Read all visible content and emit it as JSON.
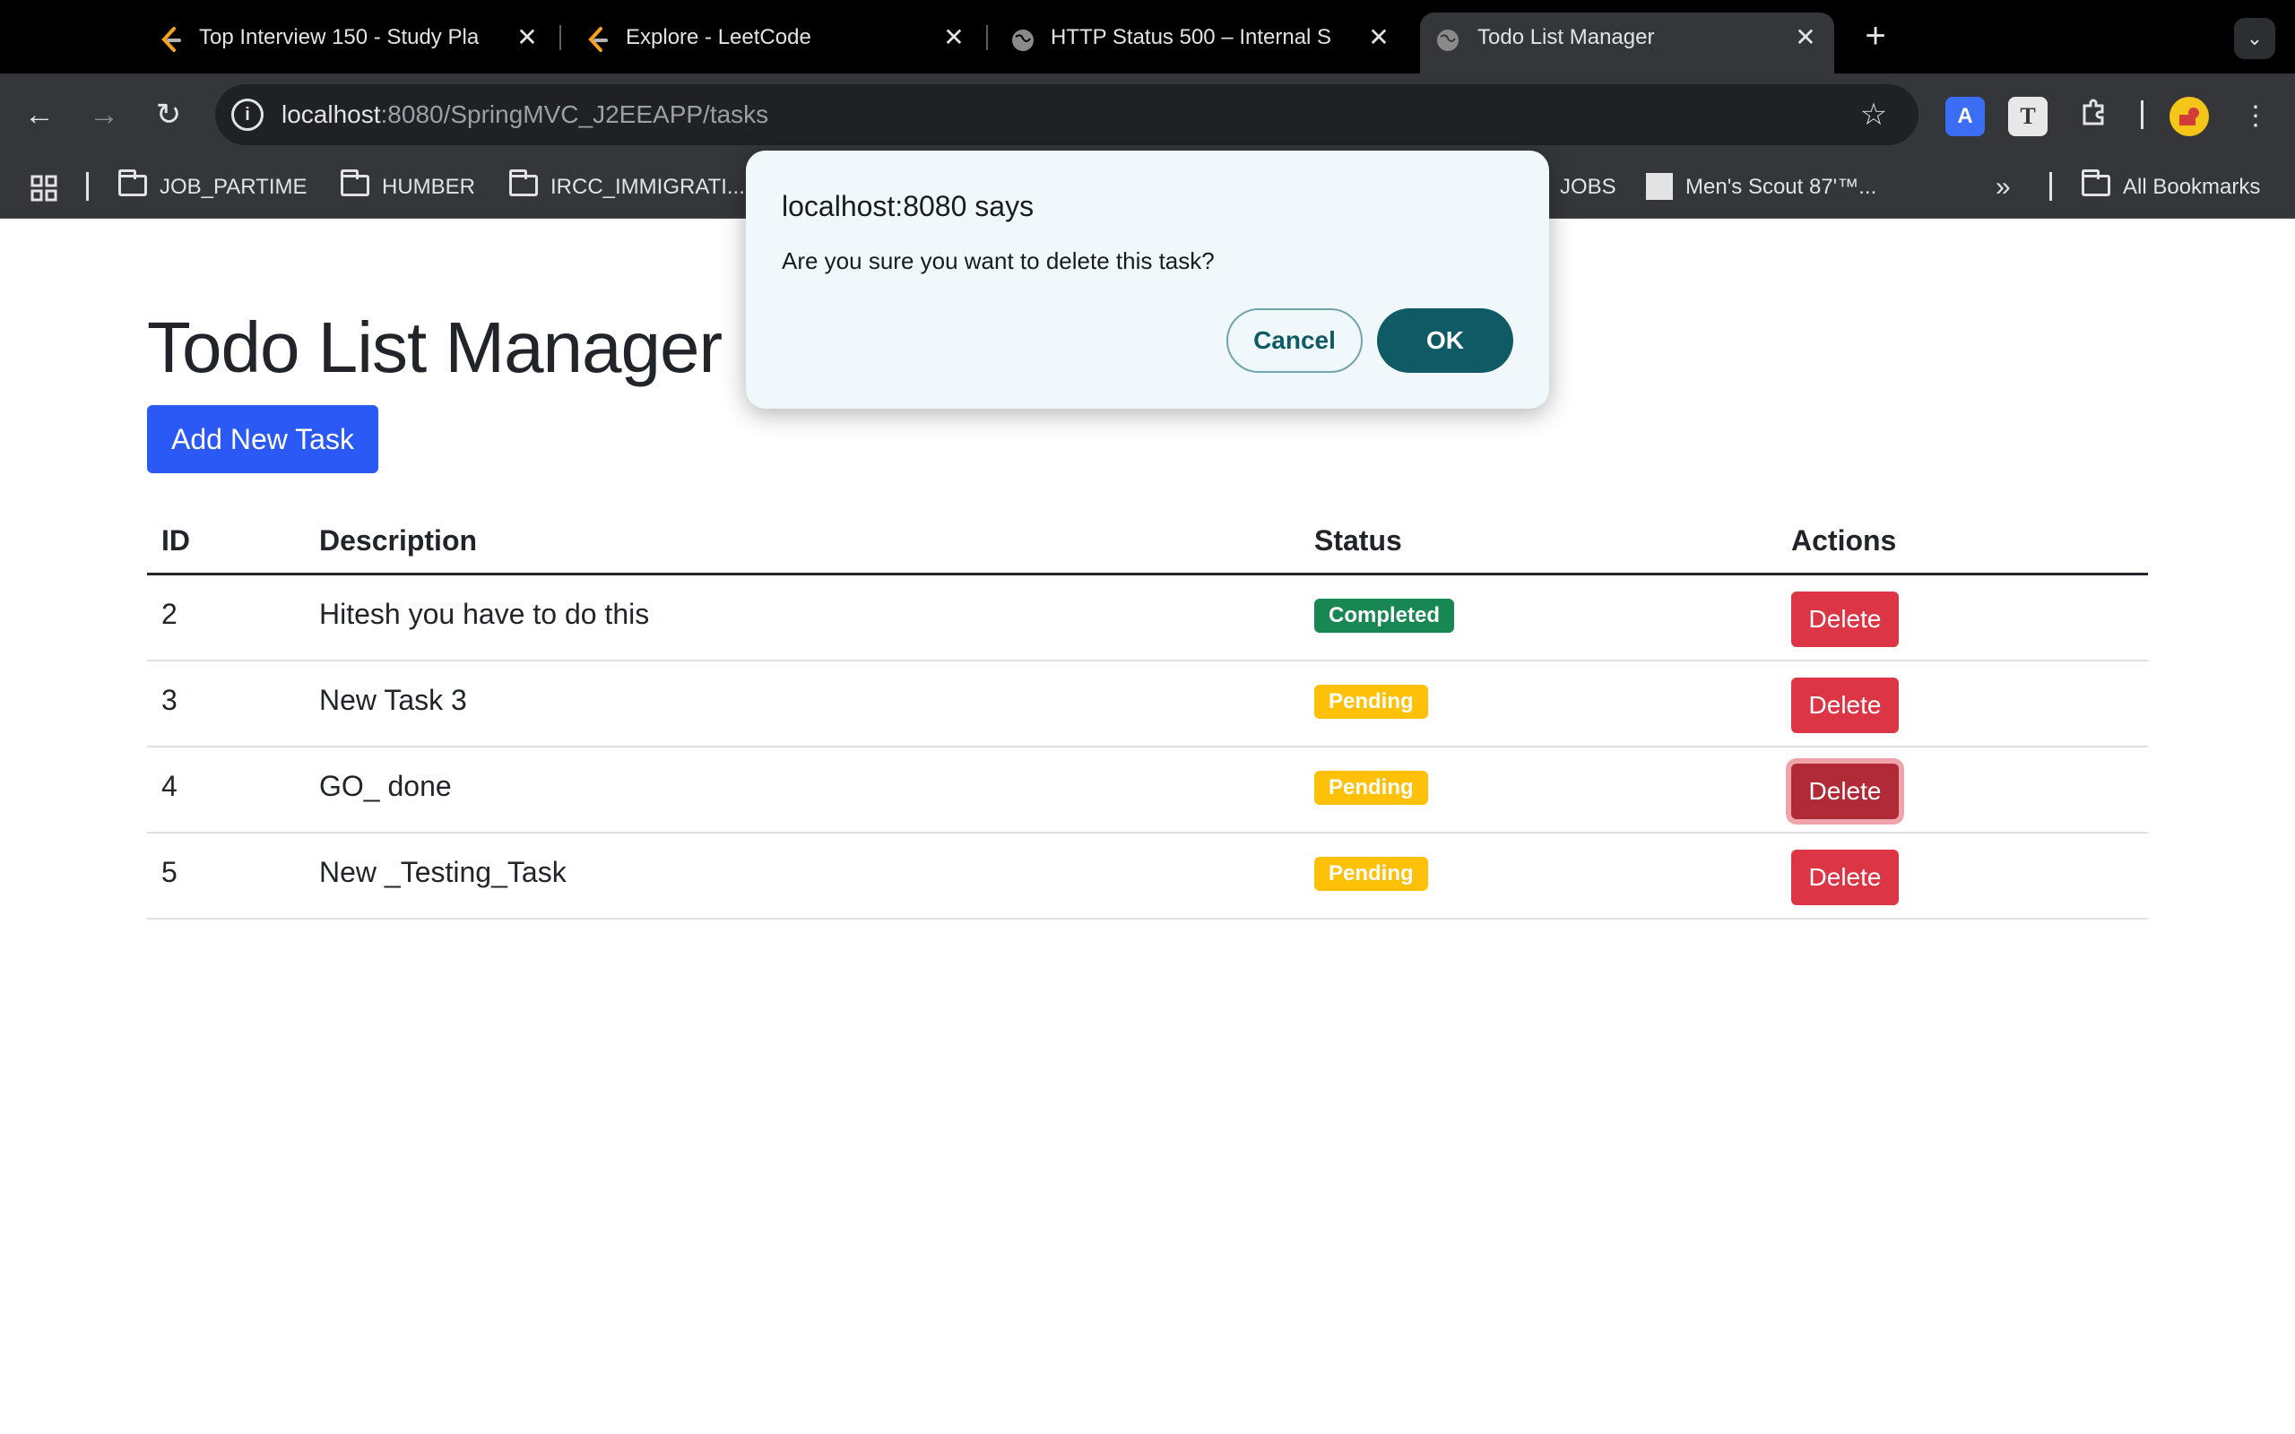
{
  "browser": {
    "tabs": [
      {
        "title": "Top Interview 150 - Study Pla",
        "icon": "leetcode-icon"
      },
      {
        "title": "Explore - LeetCode",
        "icon": "leetcode-icon"
      },
      {
        "title": "HTTP Status 500 – Internal S",
        "icon": "globe-icon"
      },
      {
        "title": "Todo List Manager",
        "icon": "globe-icon",
        "active": true
      }
    ],
    "new_tab_label": "+",
    "address": {
      "host": "localhost",
      "rest": ":8080/SpringMVC_J2EEAPP/tasks"
    },
    "bookmarks": [
      {
        "label": "JOB_PARTIME",
        "icon": "folder-icon"
      },
      {
        "label": "HUMBER",
        "icon": "folder-icon"
      },
      {
        "label": "IRCC_IMMIGRATI...",
        "icon": "folder-icon"
      },
      {
        "label": "JOBS",
        "icon": "folder-icon"
      },
      {
        "label": "Men's Scout 87'™...",
        "icon": "site-icon"
      },
      {
        "label": "All Bookmarks",
        "icon": "folder-icon"
      }
    ]
  },
  "page": {
    "title": "Todo List Manager",
    "add_button": "Add New Task",
    "table": {
      "headers": {
        "id": "ID",
        "description": "Description",
        "status": "Status",
        "actions": "Actions"
      },
      "rows": [
        {
          "id": "2",
          "description": "Hitesh you have to do this",
          "status": "Completed",
          "action": "Delete"
        },
        {
          "id": "3",
          "description": "New Task 3",
          "status": "Pending",
          "action": "Delete"
        },
        {
          "id": "4",
          "description": "GO_ done",
          "status": "Pending",
          "action": "Delete"
        },
        {
          "id": "5",
          "description": "New _Testing_Task",
          "status": "Pending",
          "action": "Delete"
        }
      ]
    }
  },
  "dialog": {
    "title": "localhost:8080 says",
    "message": "Are you sure you want to delete this task?",
    "cancel": "Cancel",
    "ok": "OK"
  },
  "colors": {
    "primary_button": "#2b59f5",
    "completed_badge": "#198754",
    "pending_badge": "#ffc107",
    "delete_button": "#dc3545",
    "dialog_accent": "#0f5a64"
  }
}
